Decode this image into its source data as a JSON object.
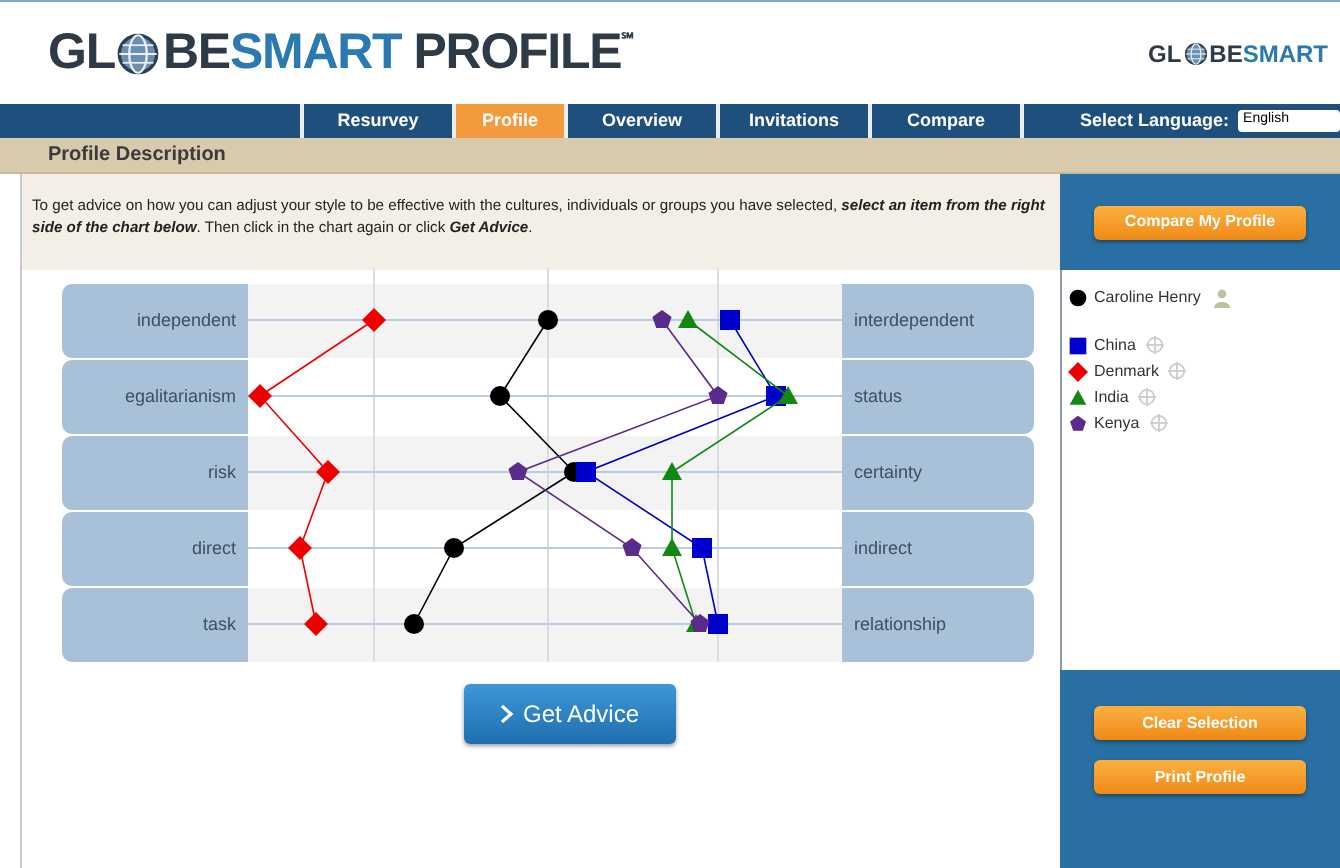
{
  "logo": {
    "before_globe": "GL",
    "after_globe": "BE",
    "accent": "SMART",
    "tail": "PROFILE",
    "mark": "℠"
  },
  "small_logo": {
    "before_globe": "GL",
    "after_globe": "BE",
    "accent": "SMART"
  },
  "nav": {
    "tabs": [
      {
        "label": "Resurvey",
        "selected": false
      },
      {
        "label": "Profile",
        "selected": true
      },
      {
        "label": "Overview",
        "selected": false
      },
      {
        "label": "Invitations",
        "selected": false
      },
      {
        "label": "Compare",
        "selected": false
      }
    ],
    "language_label": "Select Language:",
    "language_value": "English"
  },
  "section_title": "Profile Description",
  "instructions": "To get advice on how you can adjust your style to be effective with the cultures, individuals or groups you have selected, **select an item from the right side of the chart below**. Then click in the chart again or click **Get Advice**.",
  "compare_button": "Compare My Profile",
  "chart": {
    "rows": [
      {
        "left": "independent",
        "right": "interdependent"
      },
      {
        "left": "egalitarianism",
        "right": "status"
      },
      {
        "left": "risk",
        "right": "certainty"
      },
      {
        "left": "direct",
        "right": "indirect"
      },
      {
        "left": "task",
        "right": "relationship"
      }
    ]
  },
  "legend": {
    "person": {
      "name": "Caroline Henry",
      "color": "#000000",
      "kind": "circle"
    },
    "groups": [
      {
        "name": "China",
        "color": "#0000cc",
        "kind": "square"
      },
      {
        "name": "Denmark",
        "color": "#ee0000",
        "kind": "diamond"
      },
      {
        "name": "India",
        "color": "#118811",
        "kind": "triangle"
      },
      {
        "name": "Kenya",
        "color": "#5a2a8c",
        "kind": "pentagon"
      }
    ]
  },
  "advice_button": "Get Advice",
  "side_buttons": [
    "Clear Selection",
    "Print Profile"
  ]
}
